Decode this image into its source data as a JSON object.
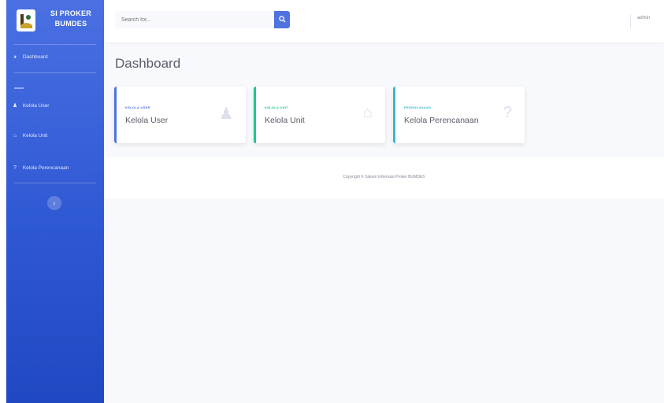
{
  "sidebar": {
    "brand": {
      "line1": "SI PROKER",
      "line2": "BUMDES"
    },
    "items": [
      {
        "label": "Dashboard",
        "icon": "tachometer-icon"
      },
      {
        "label": "Kelola User",
        "icon": "user-icon"
      },
      {
        "label": "Kelola Unit",
        "icon": "home-icon"
      },
      {
        "label": "Kelola Perencanaan",
        "icon": "question-icon"
      }
    ],
    "toggle_icon": "chevron-left-icon"
  },
  "topbar": {
    "search_placeholder": "Search for...",
    "search_icon": "search-icon",
    "user_label": "admin"
  },
  "page": {
    "title": "Dashboard"
  },
  "cards": [
    {
      "subtitle": "KELOLA USER",
      "title": "Kelola User",
      "icon": "user-icon",
      "accent": "#4e73df"
    },
    {
      "subtitle": "KELOLA UNIT",
      "title": "Kelola Unit",
      "icon": "home-icon",
      "accent": "#1cc88a"
    },
    {
      "subtitle": "PERENCANAAN",
      "title": "Kelola Perencanaan",
      "icon": "question-icon",
      "accent": "#36b9cc"
    }
  ],
  "footer": {
    "text": "Copyright © Sistem Informasi Proker BUMDES"
  },
  "colors": {
    "sidebar_top": "#4a70e2",
    "sidebar_bottom": "#2148c3",
    "primary": "#4e73df",
    "success": "#1cc88a",
    "info": "#36b9cc",
    "page_bg": "#f8f9fc"
  }
}
